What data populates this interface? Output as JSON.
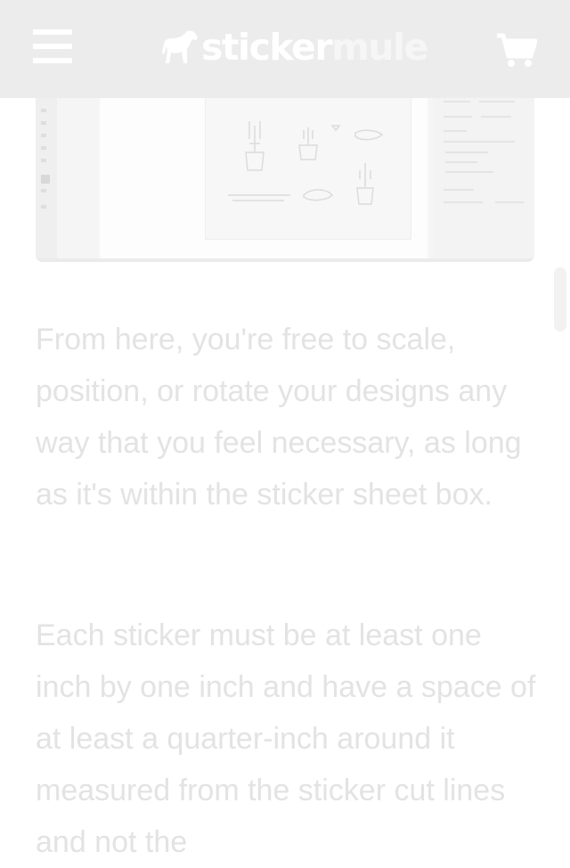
{
  "header": {
    "logo_part1": "sticker",
    "logo_part2": "mule"
  },
  "article": {
    "paragraphs": [
      "From here, you're free to scale, position, or rotate your designs any way that you feel necessary, as long as it's within the sticker sheet box.",
      "Each sticker must be at least one inch by one inch and have a space of at least a quarter-inch around it measured from the sticker cut lines and not the"
    ]
  },
  "icons": {
    "menu": "hamburger-menu-icon",
    "cart": "shopping-cart-icon",
    "logo": "horse-icon"
  },
  "colors": {
    "header_bg": "#ececec",
    "text": "#e3e3e3",
    "page_bg": "#ffffff"
  }
}
